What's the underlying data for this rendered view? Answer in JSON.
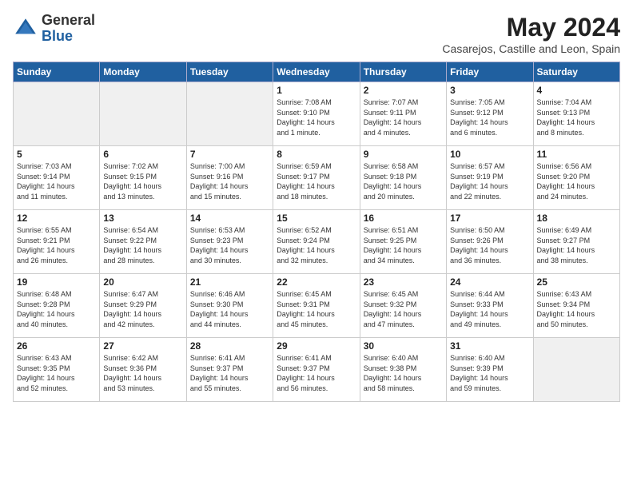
{
  "header": {
    "logo_general": "General",
    "logo_blue": "Blue",
    "title": "May 2024",
    "location": "Casarejos, Castille and Leon, Spain"
  },
  "weekdays": [
    "Sunday",
    "Monday",
    "Tuesday",
    "Wednesday",
    "Thursday",
    "Friday",
    "Saturday"
  ],
  "weeks": [
    [
      {
        "day": "",
        "info": ""
      },
      {
        "day": "",
        "info": ""
      },
      {
        "day": "",
        "info": ""
      },
      {
        "day": "1",
        "info": "Sunrise: 7:08 AM\nSunset: 9:10 PM\nDaylight: 14 hours\nand 1 minute."
      },
      {
        "day": "2",
        "info": "Sunrise: 7:07 AM\nSunset: 9:11 PM\nDaylight: 14 hours\nand 4 minutes."
      },
      {
        "day": "3",
        "info": "Sunrise: 7:05 AM\nSunset: 9:12 PM\nDaylight: 14 hours\nand 6 minutes."
      },
      {
        "day": "4",
        "info": "Sunrise: 7:04 AM\nSunset: 9:13 PM\nDaylight: 14 hours\nand 8 minutes."
      }
    ],
    [
      {
        "day": "5",
        "info": "Sunrise: 7:03 AM\nSunset: 9:14 PM\nDaylight: 14 hours\nand 11 minutes."
      },
      {
        "day": "6",
        "info": "Sunrise: 7:02 AM\nSunset: 9:15 PM\nDaylight: 14 hours\nand 13 minutes."
      },
      {
        "day": "7",
        "info": "Sunrise: 7:00 AM\nSunset: 9:16 PM\nDaylight: 14 hours\nand 15 minutes."
      },
      {
        "day": "8",
        "info": "Sunrise: 6:59 AM\nSunset: 9:17 PM\nDaylight: 14 hours\nand 18 minutes."
      },
      {
        "day": "9",
        "info": "Sunrise: 6:58 AM\nSunset: 9:18 PM\nDaylight: 14 hours\nand 20 minutes."
      },
      {
        "day": "10",
        "info": "Sunrise: 6:57 AM\nSunset: 9:19 PM\nDaylight: 14 hours\nand 22 minutes."
      },
      {
        "day": "11",
        "info": "Sunrise: 6:56 AM\nSunset: 9:20 PM\nDaylight: 14 hours\nand 24 minutes."
      }
    ],
    [
      {
        "day": "12",
        "info": "Sunrise: 6:55 AM\nSunset: 9:21 PM\nDaylight: 14 hours\nand 26 minutes."
      },
      {
        "day": "13",
        "info": "Sunrise: 6:54 AM\nSunset: 9:22 PM\nDaylight: 14 hours\nand 28 minutes."
      },
      {
        "day": "14",
        "info": "Sunrise: 6:53 AM\nSunset: 9:23 PM\nDaylight: 14 hours\nand 30 minutes."
      },
      {
        "day": "15",
        "info": "Sunrise: 6:52 AM\nSunset: 9:24 PM\nDaylight: 14 hours\nand 32 minutes."
      },
      {
        "day": "16",
        "info": "Sunrise: 6:51 AM\nSunset: 9:25 PM\nDaylight: 14 hours\nand 34 minutes."
      },
      {
        "day": "17",
        "info": "Sunrise: 6:50 AM\nSunset: 9:26 PM\nDaylight: 14 hours\nand 36 minutes."
      },
      {
        "day": "18",
        "info": "Sunrise: 6:49 AM\nSunset: 9:27 PM\nDaylight: 14 hours\nand 38 minutes."
      }
    ],
    [
      {
        "day": "19",
        "info": "Sunrise: 6:48 AM\nSunset: 9:28 PM\nDaylight: 14 hours\nand 40 minutes."
      },
      {
        "day": "20",
        "info": "Sunrise: 6:47 AM\nSunset: 9:29 PM\nDaylight: 14 hours\nand 42 minutes."
      },
      {
        "day": "21",
        "info": "Sunrise: 6:46 AM\nSunset: 9:30 PM\nDaylight: 14 hours\nand 44 minutes."
      },
      {
        "day": "22",
        "info": "Sunrise: 6:45 AM\nSunset: 9:31 PM\nDaylight: 14 hours\nand 45 minutes."
      },
      {
        "day": "23",
        "info": "Sunrise: 6:45 AM\nSunset: 9:32 PM\nDaylight: 14 hours\nand 47 minutes."
      },
      {
        "day": "24",
        "info": "Sunrise: 6:44 AM\nSunset: 9:33 PM\nDaylight: 14 hours\nand 49 minutes."
      },
      {
        "day": "25",
        "info": "Sunrise: 6:43 AM\nSunset: 9:34 PM\nDaylight: 14 hours\nand 50 minutes."
      }
    ],
    [
      {
        "day": "26",
        "info": "Sunrise: 6:43 AM\nSunset: 9:35 PM\nDaylight: 14 hours\nand 52 minutes."
      },
      {
        "day": "27",
        "info": "Sunrise: 6:42 AM\nSunset: 9:36 PM\nDaylight: 14 hours\nand 53 minutes."
      },
      {
        "day": "28",
        "info": "Sunrise: 6:41 AM\nSunset: 9:37 PM\nDaylight: 14 hours\nand 55 minutes."
      },
      {
        "day": "29",
        "info": "Sunrise: 6:41 AM\nSunset: 9:37 PM\nDaylight: 14 hours\nand 56 minutes."
      },
      {
        "day": "30",
        "info": "Sunrise: 6:40 AM\nSunset: 9:38 PM\nDaylight: 14 hours\nand 58 minutes."
      },
      {
        "day": "31",
        "info": "Sunrise: 6:40 AM\nSunset: 9:39 PM\nDaylight: 14 hours\nand 59 minutes."
      },
      {
        "day": "",
        "info": ""
      }
    ]
  ]
}
